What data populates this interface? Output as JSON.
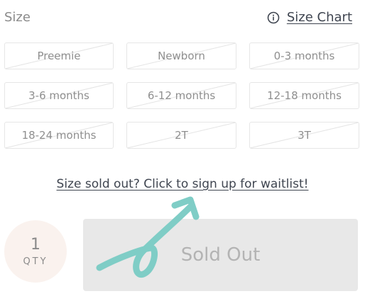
{
  "header": {
    "size_label": "Size",
    "size_chart_label": "Size Chart",
    "info_icon": "info-circle-icon"
  },
  "sizes": [
    {
      "label": "Preemie",
      "available": false
    },
    {
      "label": "Newborn",
      "available": false
    },
    {
      "label": "0-3 months",
      "available": false
    },
    {
      "label": "3-6 months",
      "available": false
    },
    {
      "label": "6-12 months",
      "available": false
    },
    {
      "label": "12-18 months",
      "available": false
    },
    {
      "label": "18-24 months",
      "available": false
    },
    {
      "label": "2T",
      "available": false
    },
    {
      "label": "3T",
      "available": false
    }
  ],
  "waitlist_link": "Size sold out? Click to sign up for waitlist!",
  "quantity": {
    "value": "1",
    "label": "QTY"
  },
  "sold_out_button": "Sold Out",
  "colors": {
    "arrow": "#7fcdc6",
    "qty_bg": "#faf2ee",
    "button_bg": "#e8e8e8"
  }
}
